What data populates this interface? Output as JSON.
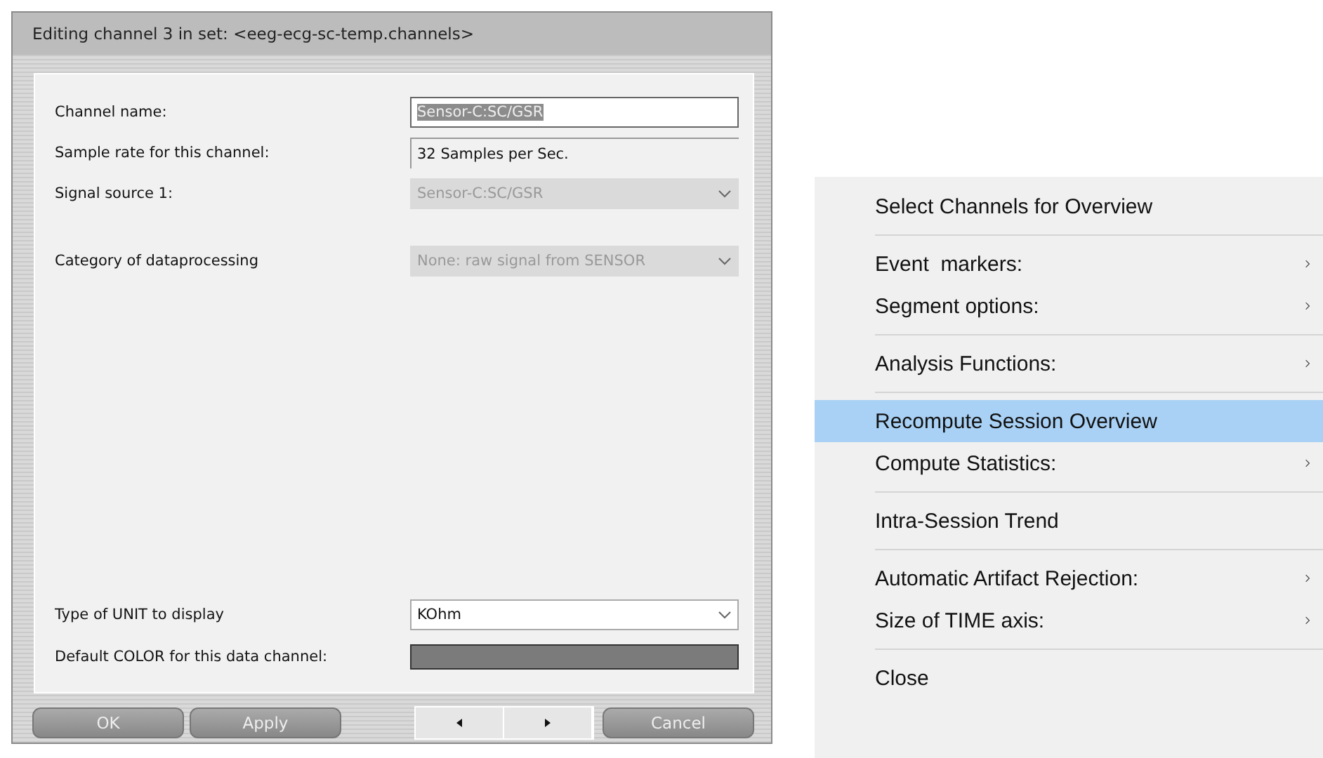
{
  "dialog": {
    "title": "Editing channel 3 in set: <eeg-ecg-sc-temp.channels>",
    "groups": [
      [
        {
          "kind": "input",
          "label": "Channel name:",
          "value": "Sensor-C:SC/GSR",
          "text_selected": true,
          "disabled": false
        },
        {
          "kind": "readonly",
          "label": "Sample rate for this channel:",
          "value": "32 Samples per Sec.",
          "disabled": false
        },
        {
          "kind": "select",
          "label": "Signal source 1:",
          "value": "Sensor-C:SC/GSR",
          "disabled": true
        }
      ],
      [
        {
          "kind": "select",
          "label": "Category of dataprocessing",
          "value": "None: raw signal from SENSOR",
          "disabled": true
        }
      ],
      [
        {
          "kind": "select",
          "label": "Type of UNIT to display",
          "value": "KOhm",
          "disabled": false
        },
        {
          "kind": "color",
          "label": "Default COLOR for this data channel:",
          "color": "#7b7b7b"
        }
      ]
    ],
    "buttons": [
      {
        "kind": "text",
        "label": "OK"
      },
      {
        "kind": "text",
        "label": "Apply"
      },
      {
        "kind": "nav"
      },
      {
        "kind": "text",
        "label": "Cancel"
      }
    ]
  },
  "menu": {
    "groups": [
      [
        {
          "label": "Select Channels for Overview",
          "submenu": false,
          "selected": false
        }
      ],
      [
        {
          "label": "Event  markers:",
          "submenu": true,
          "selected": false
        },
        {
          "label": "Segment options:",
          "submenu": true,
          "selected": false
        }
      ],
      [
        {
          "label": "Analysis Functions:",
          "submenu": true,
          "selected": false
        }
      ],
      [
        {
          "label": "Recompute Session Overview",
          "submenu": false,
          "selected": true
        },
        {
          "label": "Compute Statistics:",
          "submenu": true,
          "selected": false
        }
      ],
      [
        {
          "label": "Intra-Session Trend",
          "submenu": false,
          "selected": false
        }
      ],
      [
        {
          "label": "Automatic Artifact Rejection:",
          "submenu": true,
          "selected": false
        },
        {
          "label": "Size of TIME axis:",
          "submenu": true,
          "selected": false
        }
      ],
      [
        {
          "label": "Close",
          "submenu": false,
          "selected": false
        }
      ]
    ]
  }
}
